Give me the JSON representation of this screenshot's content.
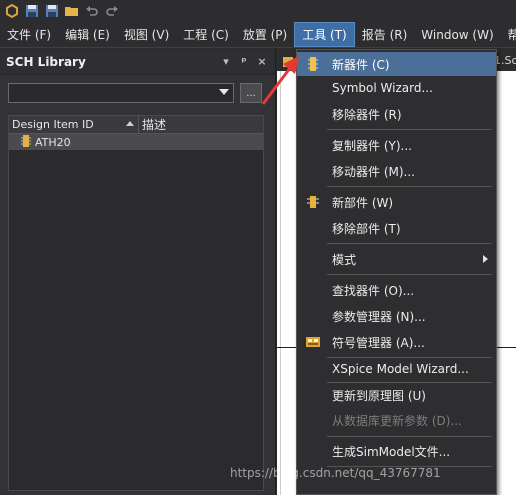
{
  "qat": {
    "icons": [
      "app-logo-icon",
      "save-icon",
      "save-all-icon",
      "open-folder-icon",
      "undo-icon",
      "redo-icon"
    ]
  },
  "menubar": {
    "items": [
      {
        "label": "文件 (F)"
      },
      {
        "label": "编辑 (E)"
      },
      {
        "label": "视图 (V)"
      },
      {
        "label": "工程 (C)"
      },
      {
        "label": "放置 (P)"
      },
      {
        "label": "工具 (T)",
        "active": true
      },
      {
        "label": "报告 (R)"
      },
      {
        "label": "Window (W)"
      },
      {
        "label": "帮"
      }
    ]
  },
  "panel": {
    "title": "SCH Library",
    "header_buttons": [
      "▾",
      "ᵖ",
      "×"
    ],
    "browse_button": "...",
    "columns": [
      "Design Item ID",
      "描述"
    ],
    "rows": [
      {
        "id": "ATH20",
        "desc": ""
      }
    ]
  },
  "editor": {
    "tab_label": "1.Sc"
  },
  "tools_menu": {
    "items": [
      {
        "label": "新器件 (C)",
        "icon": "component-icon",
        "highlighted": true
      },
      {
        "label": "Symbol Wizard..."
      },
      {
        "label": "移除器件 (R)"
      },
      {
        "label": "复制器件 (Y)..."
      },
      {
        "label": "移动器件 (M)..."
      },
      {
        "label": "新部件 (W)",
        "icon": "part-icon"
      },
      {
        "label": "移除部件 (T)"
      },
      {
        "label": "模式",
        "submenu": true
      },
      {
        "label": "查找器件 (O)..."
      },
      {
        "label": "参数管理器 (N)..."
      },
      {
        "label": "符号管理器 (A)...",
        "icon": "symbol-manager-icon"
      },
      {
        "label": "XSpice Model Wizard..."
      },
      {
        "label": "更新到原理图 (U)"
      },
      {
        "label": "从数据库更新参数 (D)...",
        "disabled": true
      },
      {
        "label": "生成SimModel文件..."
      }
    ]
  },
  "watermark": "https://blog.csdn.net/qq_43767781",
  "colors": {
    "menu_highlight": "#4b6f98",
    "active_menubar": "#3e6ea3",
    "arrow": "#e53935"
  }
}
